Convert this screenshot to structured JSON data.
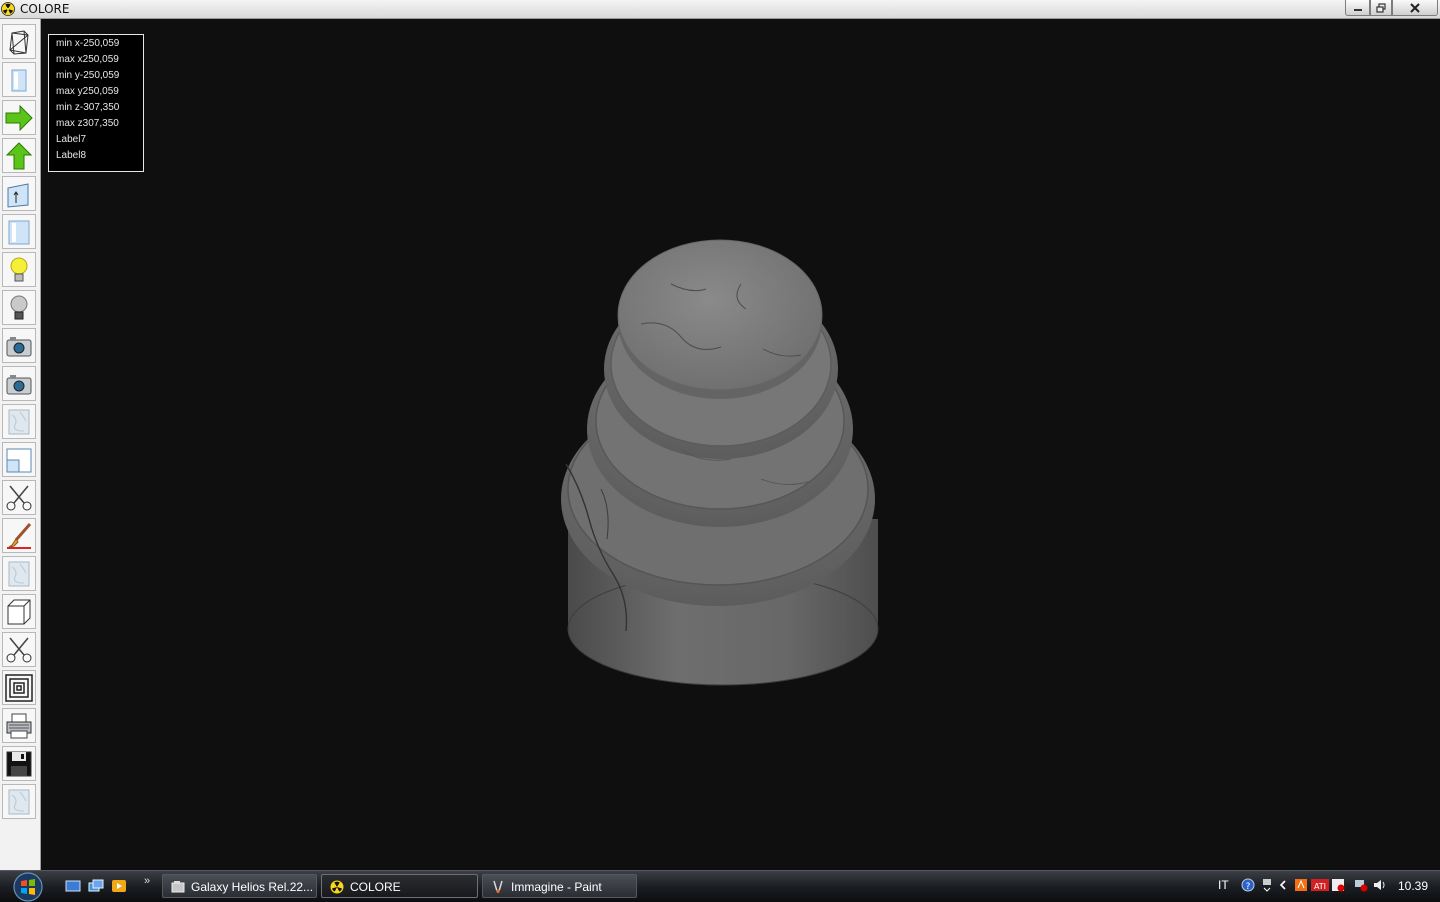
{
  "window": {
    "title": "COLORE"
  },
  "toolbar": {
    "buttons": [
      {
        "icon": "wireframe-icon",
        "label": "Wireframe"
      },
      {
        "icon": "solid-box-icon",
        "label": "Solid"
      },
      {
        "icon": "arrow-right-icon",
        "label": "Right"
      },
      {
        "icon": "arrow-up-icon",
        "label": "Up"
      },
      {
        "icon": "box-up-icon",
        "label": "Box up"
      },
      {
        "icon": "cylinder-icon",
        "label": "Cylinder"
      },
      {
        "icon": "light-on-icon",
        "label": "Light on"
      },
      {
        "icon": "light-off-icon",
        "label": "Light off"
      },
      {
        "icon": "camera-icon",
        "label": "Camera"
      },
      {
        "icon": "camera-2-icon",
        "label": "Camera 2"
      },
      {
        "icon": "texture-icon",
        "label": "Texture"
      },
      {
        "icon": "window-icon",
        "label": "Window"
      },
      {
        "icon": "scissors-icon",
        "label": "Cut"
      },
      {
        "icon": "brush-icon",
        "label": "Paint"
      },
      {
        "icon": "texture-2-icon",
        "label": "Texture 2"
      },
      {
        "icon": "cube-icon",
        "label": "Cube"
      },
      {
        "icon": "scissors-2-icon",
        "label": "Cut 2"
      },
      {
        "icon": "concentric-squares-icon",
        "label": "Concentric"
      },
      {
        "icon": "printer-icon",
        "label": "Print"
      },
      {
        "icon": "save-disk-icon",
        "label": "Save"
      },
      {
        "icon": "texture-3-icon",
        "label": "Texture 3"
      }
    ]
  },
  "info": {
    "lines": [
      "min x-250,059",
      "max x250,059",
      "min y-250,059",
      "max y250,059",
      "min z-307,350",
      "max z307,350",
      "Label7",
      "Label8"
    ]
  },
  "taskbar": {
    "tasks": [
      {
        "label": "Galaxy Helios  Rel.22...",
        "icon": "folder-icon",
        "active": false
      },
      {
        "label": "COLORE",
        "icon": "radiation-icon",
        "active": true
      },
      {
        "label": "Immagine - Paint",
        "icon": "paint-icon",
        "active": false
      }
    ],
    "language": "IT",
    "clock": "10.39",
    "quicklaunch_more": "»"
  },
  "colors": {
    "viewport_bg": "#0f0f0f",
    "taskbar": "#1c1f24",
    "model_gray": "#6e6e6e"
  }
}
